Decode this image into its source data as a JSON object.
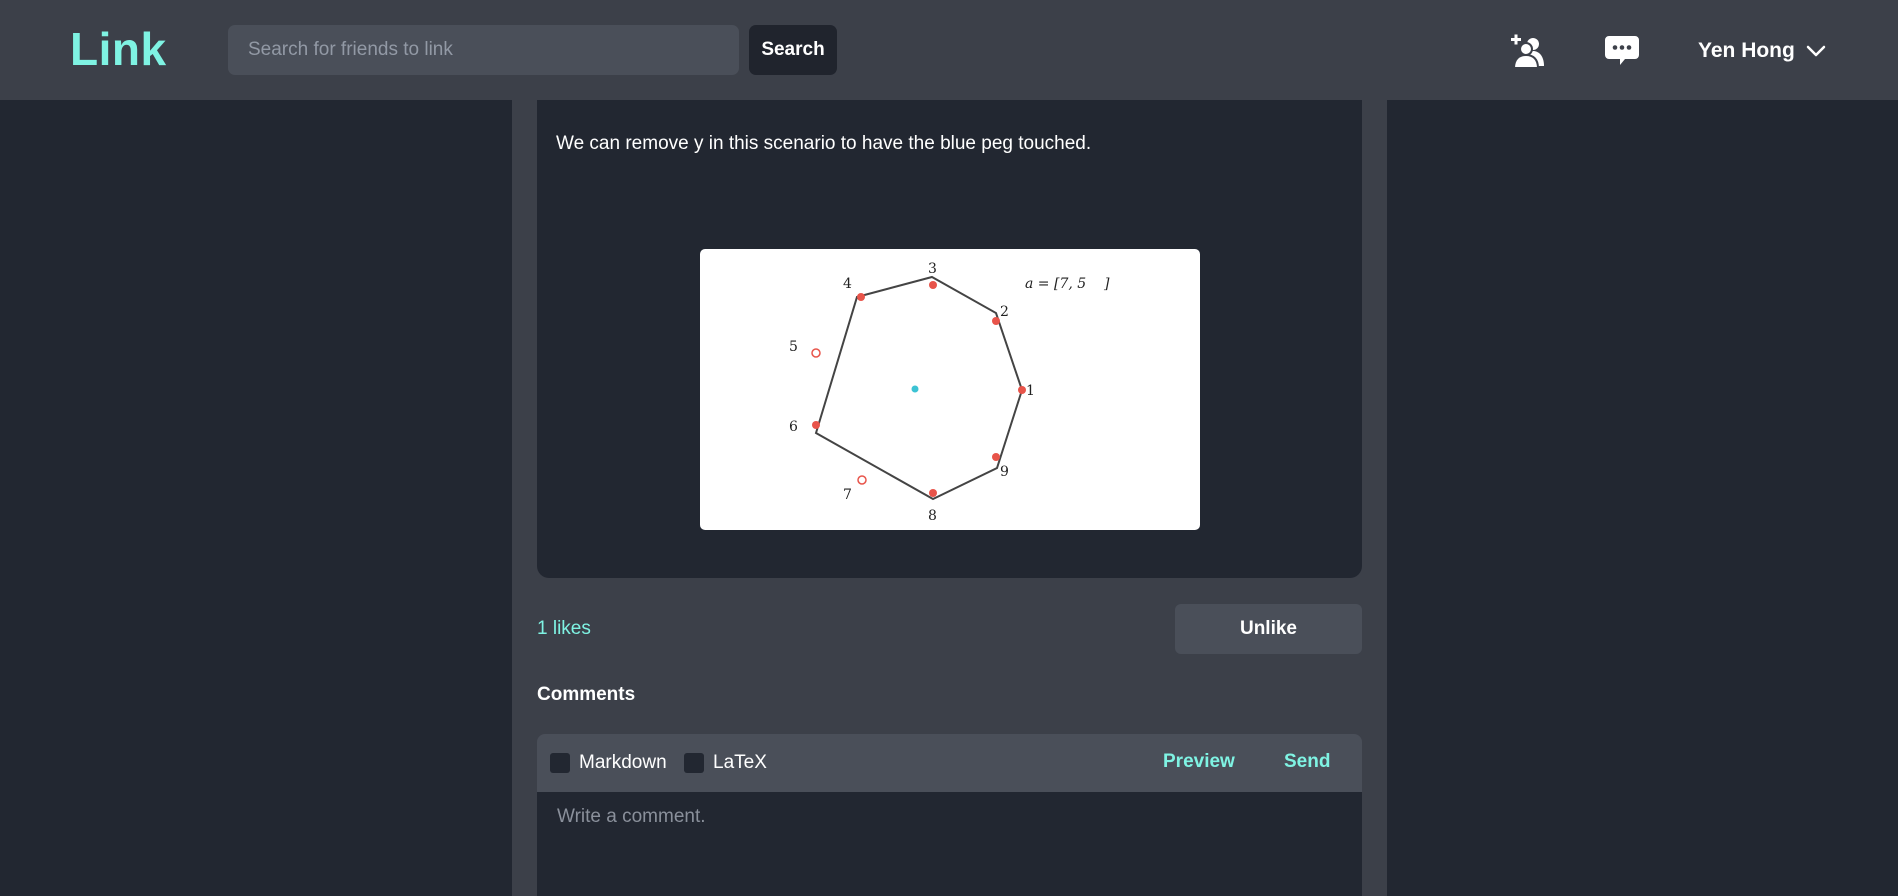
{
  "header": {
    "logo": "Link",
    "search": {
      "placeholder": "Search for friends to link",
      "button_label": "Search"
    },
    "icons": [
      "add-friend-icon",
      "messages-icon",
      "chevron-down-icon"
    ],
    "user_name": "Yen Hong"
  },
  "post": {
    "text": "We can remove y in this scenario to have the blue peg touched.",
    "figure": {
      "formula": "a = [7, 5    ]",
      "vertex_labels": [
        "1",
        "2",
        "3",
        "4",
        "5",
        "6",
        "7",
        "8",
        "9"
      ],
      "colors": {
        "filled_peg": "#e8544a",
        "hollow_peg": "#e8544a",
        "center_peg": "#3cc3d4",
        "edge": "#444444"
      }
    }
  },
  "actions": {
    "likes_text": "1 likes",
    "unlike_label": "Unlike"
  },
  "comments": {
    "heading": "Comments",
    "markdown_label": "Markdown",
    "latex_label": "LaTeX",
    "preview_label": "Preview",
    "send_label": "Send",
    "placeholder": "Write a comment."
  },
  "colors": {
    "accent": "#7ff3e3",
    "header_bg": "#3c4049",
    "page_bg": "#222731",
    "input_bg": "#4a4f59"
  }
}
